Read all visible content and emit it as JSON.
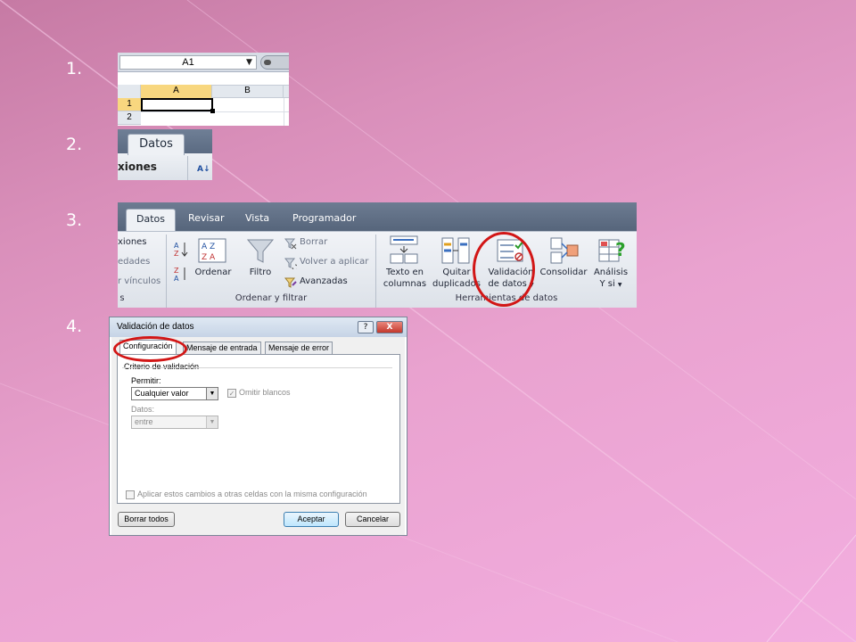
{
  "steps": {
    "one": "1.",
    "two": "2.",
    "three": "3.",
    "four": "4."
  },
  "shot1": {
    "name_box": "A1",
    "col_a": "A",
    "col_b": "B",
    "row_1": "1",
    "row_2": "2"
  },
  "shot2": {
    "tab": "Datos",
    "group_partial": "xiones"
  },
  "ribbon": {
    "tabs": [
      "Datos",
      "Revisar",
      "Vista",
      "Programador"
    ],
    "conexiones": [
      "xiones",
      "edades",
      "r vínculos"
    ],
    "group_partial": "s",
    "ordenar": "Ordenar",
    "filtro": "Filtro",
    "borrar": "Borrar",
    "volver": "Volver a aplicar",
    "avanzadas": "Avanzadas",
    "group_ordenar": "Ordenar y filtrar",
    "texto_columnas": [
      "Texto en",
      "columnas"
    ],
    "quitar_duplicados": [
      "Quitar",
      "duplicados"
    ],
    "validacion": [
      "Validación",
      "de datos"
    ],
    "consolidar": "Consolidar",
    "analisis": [
      "Análisis",
      "Y si"
    ],
    "group_herramientas": "Herramientas de datos",
    "highlight_color": "#d21616"
  },
  "dialog": {
    "title": "Validación de datos",
    "help": "?",
    "close": "X",
    "tabs": [
      "Configuración",
      "Mensaje de entrada",
      "Mensaje de error"
    ],
    "criterio": "Criterio de validación",
    "permitir_label": "Permitir:",
    "permitir_value": "Cualquier valor",
    "omitir": "Omitir blancos",
    "datos_label": "Datos:",
    "datos_value": "entre",
    "aplicar": "Aplicar estos cambios a otras celdas con la misma configuración",
    "borrar_todos": "Borrar todos",
    "aceptar": "Aceptar",
    "cancelar": "Cancelar"
  }
}
